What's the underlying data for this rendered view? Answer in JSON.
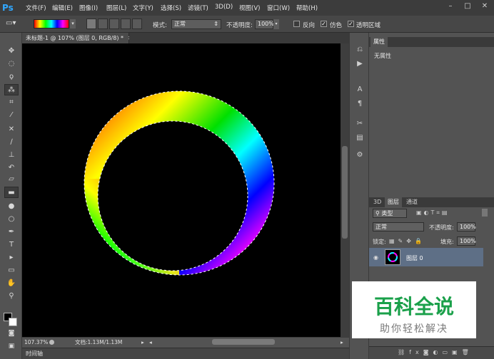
{
  "app": {
    "logo": "Ps",
    "menu": [
      "文件(F)",
      "编辑(E)",
      "图像(I)",
      "图层(L)",
      "文字(Y)",
      "选择(S)",
      "滤镜(T)",
      "3D(D)",
      "视图(V)",
      "窗口(W)",
      "帮助(H)"
    ],
    "window_controls": [
      "–",
      "□",
      "✕"
    ]
  },
  "options_bar": {
    "mode_label": "模式:",
    "mode_value": "正常",
    "opacity_label": "不透明度:",
    "opacity_value": "100%",
    "reverse_label": "反向",
    "dither_label": "仿色",
    "transparency_label": "透明区域",
    "dither_checked": "✓",
    "transparency_checked": "✓"
  },
  "document": {
    "tab_title": "未标题-1 @ 107% (图层 0, RGB/8) *",
    "tab_close": "✕",
    "zoom": "107.37%",
    "doc_info": "文档:1.13M/1.13M",
    "timeline": "时间轴"
  },
  "properties_panel": {
    "tab": "属性",
    "content": "无属性"
  },
  "layers_panel": {
    "tabs": [
      "3D",
      "图层",
      "通道"
    ],
    "filter_value": "类型",
    "blend_mode": "正常",
    "opacity_label": "不透明度:",
    "opacity_value": "100%",
    "lock_label": "锁定:",
    "fill_label": "填充:",
    "fill_value": "100%",
    "layers": [
      {
        "name": "图层 0"
      }
    ]
  },
  "watermark": {
    "title": "百科全说",
    "subtitle": "助你轻松解决"
  },
  "colors": {
    "accent": "#31a8ff",
    "layer_selected": "#5e6f86",
    "watermark_green": "#1aa04a"
  },
  "icons": {
    "tools": [
      "move-icon",
      "marquee-icon",
      "lasso-icon",
      "magic-wand-icon",
      "crop-icon",
      "eyedropper-icon",
      "healing-icon",
      "brush-icon",
      "stamp-icon",
      "history-brush-icon",
      "eraser-icon",
      "gradient-icon",
      "blur-icon",
      "dodge-icon",
      "pen-icon",
      "type-icon",
      "path-select-icon",
      "shape-icon",
      "hand-icon",
      "zoom-icon"
    ]
  }
}
